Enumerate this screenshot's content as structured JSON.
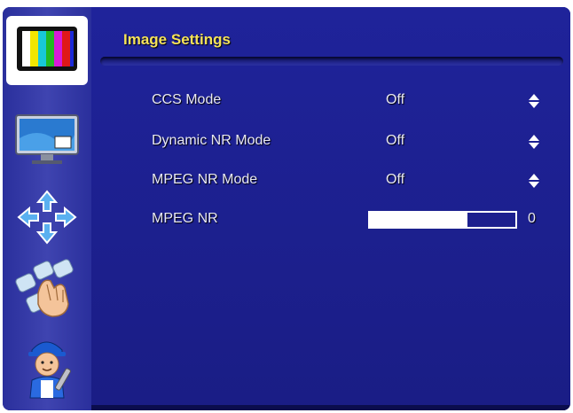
{
  "menu": {
    "title": "Image Settings",
    "sidebar": [
      {
        "name": "image-tab",
        "icon": "color-bars-tv-icon",
        "active": true
      },
      {
        "name": "display-tab",
        "icon": "monitor-icon",
        "active": false
      },
      {
        "name": "position-tab",
        "icon": "arrows-icon",
        "active": false
      },
      {
        "name": "control-tab",
        "icon": "hand-icon",
        "active": false
      },
      {
        "name": "service-tab",
        "icon": "technician-icon",
        "active": false
      }
    ],
    "items": [
      {
        "label": "CCS Mode",
        "value": "Off",
        "type": "select"
      },
      {
        "label": "Dynamic NR Mode",
        "value": "Off",
        "type": "select"
      },
      {
        "label": "MPEG NR Mode",
        "value": "Off",
        "type": "select"
      },
      {
        "label": "MPEG NR",
        "value": "0",
        "type": "slider",
        "level": 0.67
      }
    ]
  },
  "colors": {
    "panel": "#1c1f8e",
    "title": "#f4e25a",
    "text": "#e8e8f4"
  }
}
